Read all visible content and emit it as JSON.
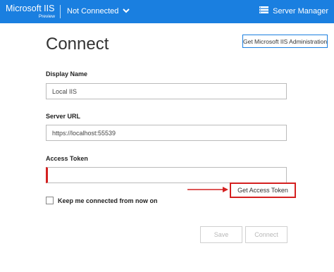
{
  "header": {
    "brand_title": "Microsoft IIS",
    "brand_subtitle": "Preview",
    "connection_status": "Not Connected",
    "server_manager_label": "Server Manager",
    "background_color": "#1a7fe0"
  },
  "main": {
    "title": "Connect",
    "admin_button_label": "Get Microsoft IIS Administration",
    "display_name": {
      "label": "Display Name",
      "value": "Local IIS"
    },
    "server_url": {
      "label": "Server URL",
      "value": "https://localhost:55539"
    },
    "access_token": {
      "label": "Access Token",
      "value": ""
    },
    "get_token_label": "Get Access Token",
    "keep_connected_label": "Keep me connected from now on",
    "keep_connected_checked": false,
    "save_label": "Save",
    "connect_label": "Connect"
  },
  "annotation_color": "#d42020",
  "icons": [
    "chevron-down-icon",
    "server-list-icon",
    "arrow-right-icon"
  ]
}
